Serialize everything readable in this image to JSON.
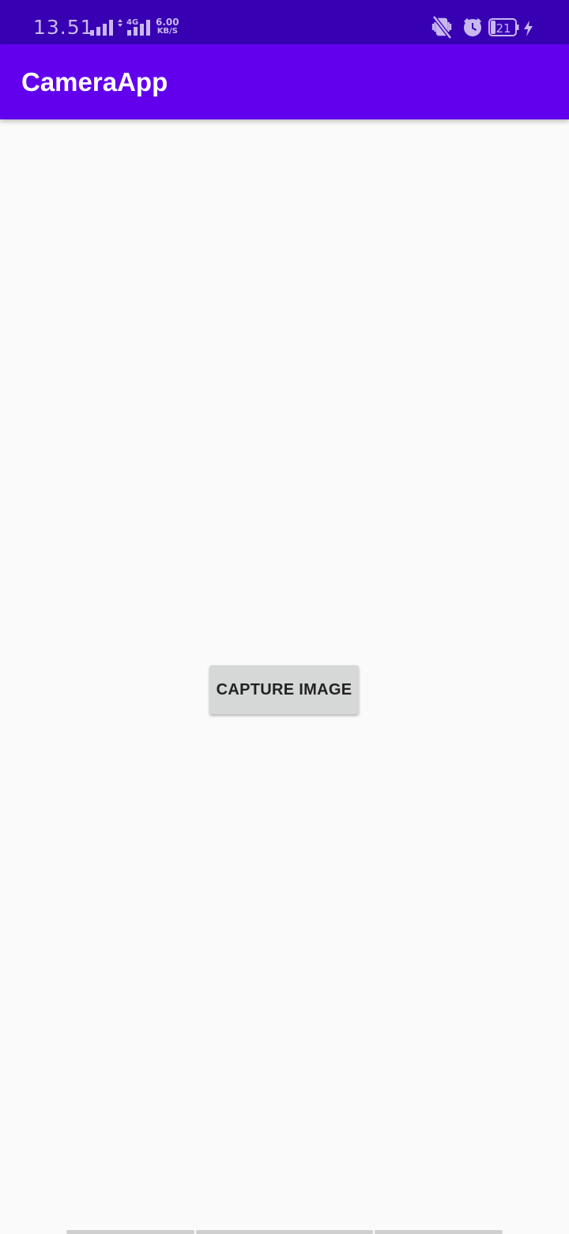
{
  "status_bar": {
    "time": "13.51",
    "network_type": "4G",
    "net_speed_value": "6.00",
    "net_speed_unit": "KB/S",
    "battery_level": "21",
    "icons": [
      "signal-bars-icon",
      "data-arrows-icon",
      "signal-bars-4g-icon",
      "vibrate-mute-icon",
      "alarm-clock-icon",
      "battery-icon",
      "charging-bolt-icon"
    ]
  },
  "app_bar": {
    "title": "CameraApp"
  },
  "main": {
    "capture_button_label": "CAPTURE IMAGE"
  },
  "colors": {
    "status_bar": "#3700b3",
    "app_bar": "#6200ee",
    "background": "#fafafa",
    "button": "#d6d7d7"
  }
}
